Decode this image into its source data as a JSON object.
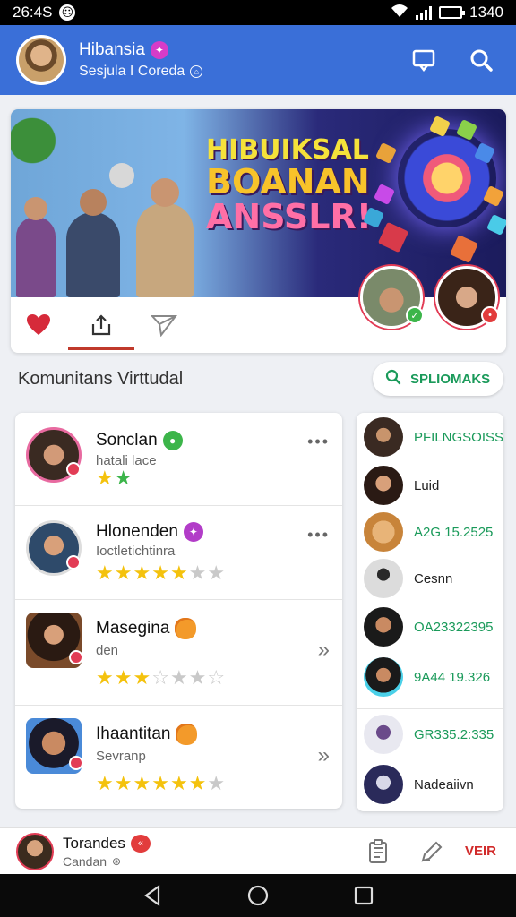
{
  "status": {
    "time": "26:4S",
    "battery": "1340"
  },
  "header": {
    "title": "Hibansia",
    "subtitle": "Sesjula I Coreda",
    "colors": {
      "bar": "#3a6fd8"
    }
  },
  "banner": {
    "headline": [
      "HIBUIKSAL",
      "BOANAN",
      "ANSSLR!"
    ]
  },
  "section": {
    "title": "Komunitans Virttudal",
    "search_label": "SPLIOMAKS"
  },
  "members": [
    {
      "name": "Sonclan",
      "sub": "hatali lace",
      "rating": 2,
      "max": 2,
      "action": "more"
    },
    {
      "name": "Hlonenden",
      "sub": "Ioctletichtinra",
      "rating": 5,
      "max": 7,
      "action": "more"
    },
    {
      "name": "Masegina",
      "sub": "den",
      "rating": 3,
      "max": 7,
      "action": "chevron"
    },
    {
      "name": "Ihaantitan",
      "sub": "Sevranp",
      "rating": 6,
      "max": 7,
      "action": "chevron"
    }
  ],
  "side_list": [
    {
      "text": "PFILNGSOISS",
      "green": true
    },
    {
      "text": "Luid",
      "green": false
    },
    {
      "text": "A2G 15.2525",
      "green": true
    },
    {
      "text": "Cesnn",
      "green": false
    },
    {
      "text": "OA23322395",
      "green": true
    },
    {
      "text": "9A44 19.326",
      "green": true
    },
    {
      "text": "GR335.2:335",
      "green": true
    },
    {
      "text": "Nadeaiivn",
      "green": false
    }
  ],
  "bottom": {
    "name": "Torandes",
    "sub": "Candan",
    "view_label": "VEIR"
  }
}
